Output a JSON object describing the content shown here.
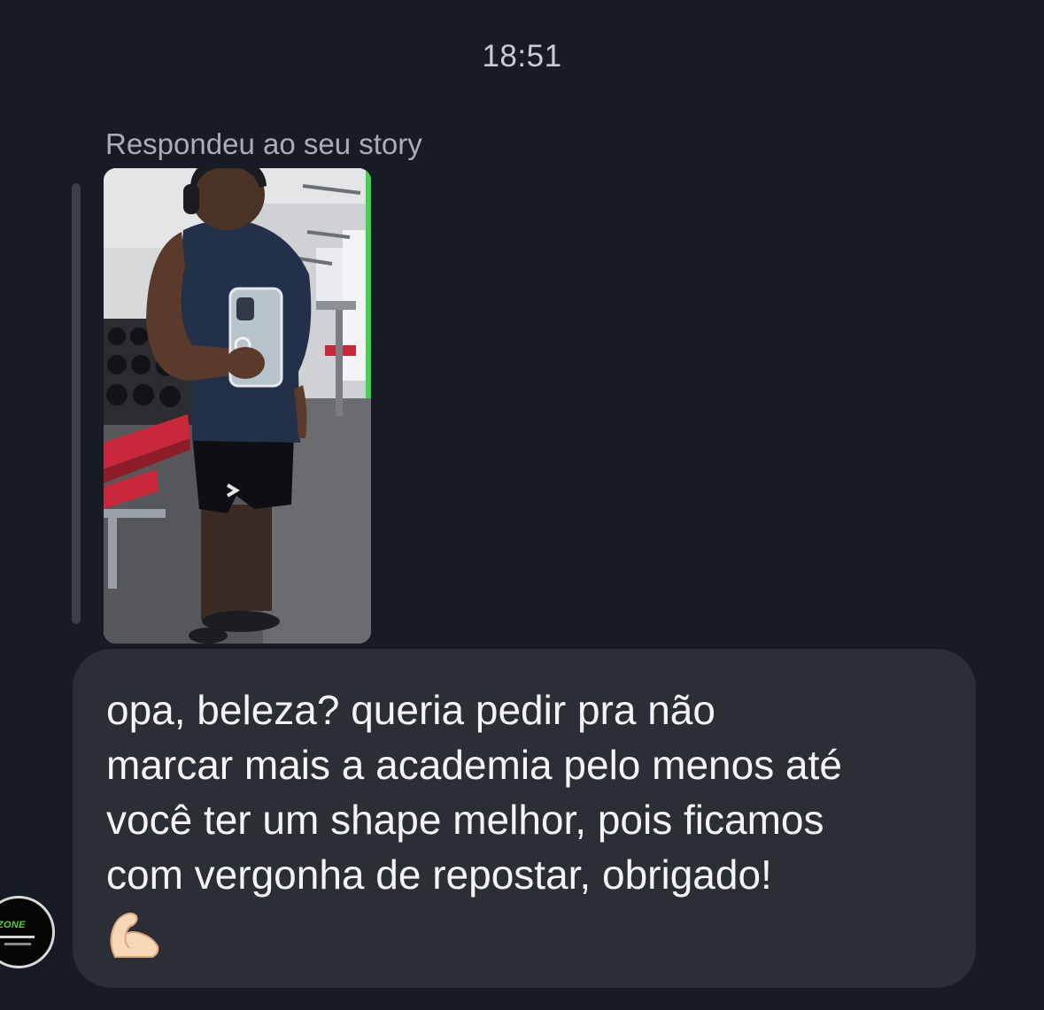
{
  "chat": {
    "timestamp": "18:51",
    "reply_caption": "Respondeu ao seu story",
    "story": {
      "description_icon": "story-photo"
    },
    "message": {
      "text": "opa, beleza? queria pedir pra não\nmarcar mais a academia pelo menos até\nvocê ter um shape melhor, pois ficamos\ncom vergonha de repostar, obrigado!",
      "emoji": "💪🏻"
    },
    "sender": {
      "avatar_text": "ZONE"
    }
  },
  "colors": {
    "background": "#171b26",
    "bubble": "#2c2e35",
    "caption": "#a9adb7",
    "accent_green": "#5fcf2e"
  }
}
